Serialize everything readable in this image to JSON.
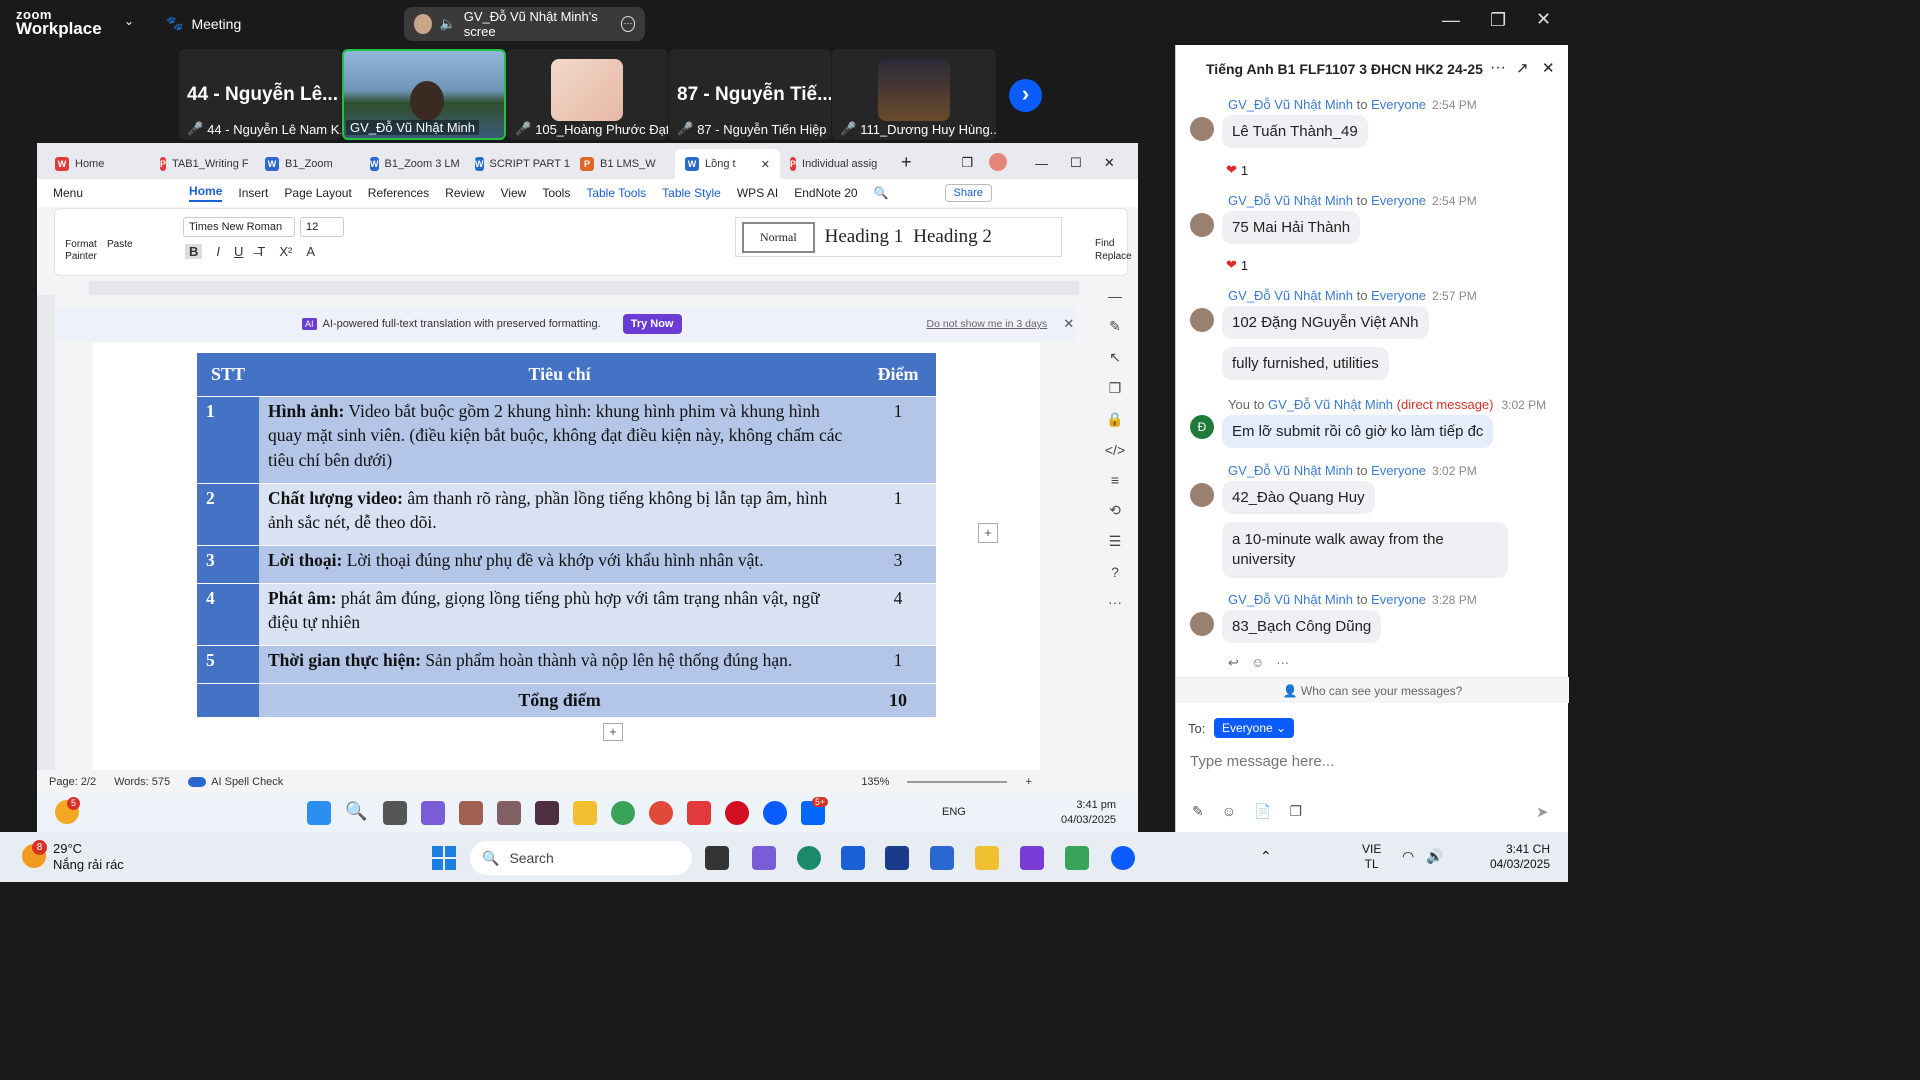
{
  "zoom": {
    "logo_top": "zoom",
    "logo_bottom": "Workplace",
    "meeting_label": "Meeting",
    "share_label": "GV_Đỗ Vũ Nhật Minh's scree"
  },
  "participants": [
    {
      "big": "44 - Nguyễn Lê...",
      "name": "44 - Nguyễn Lê Nam K..."
    },
    {
      "big": "",
      "name": "GV_Đỗ Vũ Nhật Minh"
    },
    {
      "big": "",
      "name": "105_Hoàng Phước Đạt..."
    },
    {
      "big": "87 - Nguyễn Tiế...",
      "name": "87 - Nguyễn Tiến Hiệp"
    },
    {
      "big": "",
      "name": "111_Dương Huy Hùng..."
    }
  ],
  "word": {
    "tabs": [
      "Home",
      "TAB1_Writing F",
      "B1_Zoom",
      "B1_Zoom 3 LM",
      "SCRIPT PART 1",
      "B1 LMS_W",
      "Lồng t",
      "Individual assig"
    ],
    "menu": [
      "Menu",
      "Home",
      "Insert",
      "Page Layout",
      "References",
      "Review",
      "View",
      "Tools",
      "Table Tools",
      "Table Style",
      "WPS AI",
      "EndNote 20"
    ],
    "share": "Share",
    "font": "Times New Roman",
    "font_size": "12",
    "format_painter": "Format Painter",
    "paste": "Paste",
    "styles": [
      "Normal",
      "Heading 1",
      "Heading 2"
    ],
    "find": "Find Replace",
    "banner_text": "AI-powered full-text translation with preserved formatting.",
    "banner_button": "Try Now",
    "banner_dismiss": "Do not show me in 3 days",
    "status_page": "Page: 2/2",
    "status_words": "Words: 575",
    "status_spell": "AI Spell Check",
    "zoom_level": "135%"
  },
  "rubric": {
    "headers": [
      "STT",
      "Tiêu chí",
      "Điểm"
    ],
    "rows": [
      {
        "n": "1",
        "bold": "Hình ảnh:",
        "text": " Video bắt buộc gồm 2 khung hình: khung hình phim và khung hình quay mặt sinh viên. (điều kiện bắt buộc, không đạt điều kiện này, không chấm các tiêu chí bên dưới)",
        "score": "1"
      },
      {
        "n": "2",
        "bold": "Chất lượng video:",
        "text": " âm thanh rõ ràng, phần lồng tiếng không bị lẫn tạp âm, hình ảnh sắc nét, dễ theo dõi.",
        "score": "1"
      },
      {
        "n": "3",
        "bold": "Lời thoại:",
        "text": " Lời thoại đúng như phụ đề và khớp với khẩu hình nhân vật.",
        "score": "3"
      },
      {
        "n": "4",
        "bold": "Phát âm:",
        "text": " phát âm đúng, giọng lồng tiếng phù hợp với tâm trạng nhân vật, ngữ điệu tự nhiên",
        "score": "4"
      },
      {
        "n": "5",
        "bold": "Thời gian thực hiện:",
        "text": " Sản phẩm hoàn thành và nộp lên hệ thống đúng hạn.",
        "score": "1"
      }
    ],
    "total_label": "Tổng điểm",
    "total_score": "10"
  },
  "chat": {
    "title": "Tiếng Anh B1 FLF1107 3 ĐHCN HK2 24-25",
    "messages": [
      {
        "from": "GV_Đỗ Vũ Nhật Minh",
        "to": "to",
        "audience": "Everyone",
        "time": "2:54 PM",
        "texts": [
          "Lê Tuấn Thành_49"
        ],
        "reaction": "1"
      },
      {
        "from": "GV_Đỗ Vũ Nhật Minh",
        "to": "to",
        "audience": "Everyone",
        "time": "2:54 PM",
        "texts": [
          "75 Mai Hải Thành"
        ],
        "reaction": "1"
      },
      {
        "from": "GV_Đỗ Vũ Nhật Minh",
        "to": "to",
        "audience": "Everyone",
        "time": "2:57 PM",
        "texts": [
          "102 Đặng NGuyễn Việt ANh",
          "fully furnished, utilities"
        ]
      },
      {
        "from": "You",
        "to": "to",
        "audience": "GV_Đỗ Vũ Nhật Minh",
        "note": "(direct message)",
        "time": "3:02 PM",
        "texts": [
          "Em lỡ submit rồi cô giờ ko làm tiếp đc"
        ],
        "avatar": "Đ"
      },
      {
        "from": "GV_Đỗ Vũ Nhật Minh",
        "to": "to",
        "audience": "Everyone",
        "time": "3:02 PM",
        "texts": [
          "42_Đào Quang Huy",
          "a 10-minute walk away from the",
          "university"
        ]
      },
      {
        "from": "GV_Đỗ Vũ Nhật Minh",
        "to": "to",
        "audience": "Everyone",
        "time": "3:28 PM",
        "texts": [
          "83_Bạch Công Dũng"
        ]
      }
    ],
    "who_can_see": "Who can see your messages?",
    "to_label": "To:",
    "recipient": "Everyone",
    "input_placeholder": "Type message here..."
  },
  "word_taskbar": {
    "weather_badge": "5",
    "lang": "ENG",
    "time": "3:41 pm",
    "date": "04/03/2025",
    "zalo_badge": "5+"
  },
  "taskbar": {
    "temp": "29°C",
    "weather": "Nắng rải rác",
    "weather_badge": "8",
    "search": "Search",
    "lang1": "VIE",
    "lang2": "TL",
    "time": "3:41 CH",
    "date": "04/03/2025"
  }
}
